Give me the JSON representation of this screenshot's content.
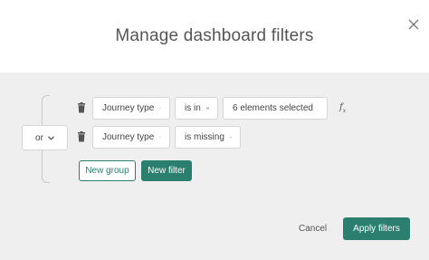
{
  "modal": {
    "title": "Manage dashboard filters",
    "close_icon": "close-icon"
  },
  "group": {
    "logic_operator": "or",
    "filters": [
      {
        "field": "Journey type",
        "operator": "is in",
        "value": "6 elements selected",
        "has_formula": true
      },
      {
        "field": "Journey type",
        "operator": "is missing",
        "value": null,
        "has_formula": false
      }
    ],
    "formula_label": "f",
    "formula_sub": "x",
    "new_group_label": "New group",
    "new_filter_label": "New filter"
  },
  "footer": {
    "cancel_label": "Cancel",
    "apply_label": "Apply filters"
  },
  "colors": {
    "accent": "#2a7f6e",
    "panel_bg": "#efefef"
  },
  "icons": {
    "delete": "trash-icon",
    "dropdown": "chevron-down-icon",
    "formula": "function-icon"
  }
}
